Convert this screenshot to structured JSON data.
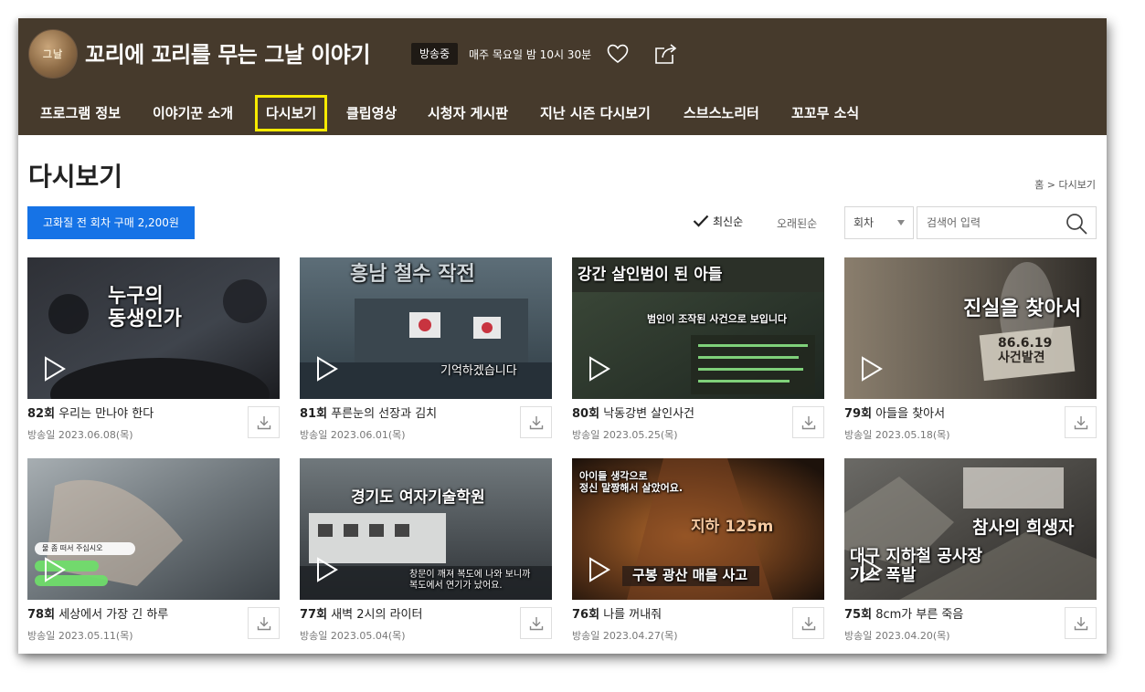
{
  "header": {
    "logo_text": "그날",
    "title": "꼬리에 꼬리를 무는 그날 이야기",
    "badge": "방송중",
    "schedule": "매주 목요일 밤 10시 30분",
    "heart_icon": "heart-icon",
    "share_icon": "share-icon"
  },
  "nav": {
    "items": [
      {
        "label": "프로그램 정보"
      },
      {
        "label": "이야기꾼 소개"
      },
      {
        "label": "다시보기",
        "active": true
      },
      {
        "label": "클립영상"
      },
      {
        "label": "시청자 게시판"
      },
      {
        "label": "지난 시즌 다시보기"
      },
      {
        "label": "스브스노리터"
      },
      {
        "label": "꼬꼬무 소식"
      }
    ],
    "active_color": "#f6ea00"
  },
  "page": {
    "title": "다시보기",
    "breadcrumb": "홈 > 다시보기"
  },
  "toolbar": {
    "buy_label": "고화질 전 회차 구매 2,200원",
    "sort_latest": "최신순",
    "sort_oldest": "오래된순",
    "select_value": "회차",
    "search_placeholder": "검색어 입력"
  },
  "colors": {
    "header_bg": "#463a2c",
    "accent_blue": "#1673e6",
    "highlight_yellow": "#f6ea00"
  },
  "episodes": [
    {
      "num": "82회",
      "title": "우리는 만나야 한다",
      "date": "방송일 2023.06.08(목)",
      "caption": "누구의\n동생인가"
    },
    {
      "num": "81회",
      "title": "푸른눈의 선장과 김치",
      "date": "방송일 2023.06.01(목)",
      "caption": "흥남 철수 작전",
      "caption2": "기억하겠습니다"
    },
    {
      "num": "80회",
      "title": "낙동강변 살인사건",
      "date": "방송일 2023.05.25(목)",
      "caption": "강간 살인범이 된 아들",
      "caption2": "범인이 조작된 사건으로 보입니다"
    },
    {
      "num": "79회",
      "title": "아들을 찾아서",
      "date": "방송일 2023.05.18(목)",
      "caption": "진실을 찾아서",
      "caption2": "86.6.19\n사건발견"
    },
    {
      "num": "78회",
      "title": "세상에서 가장 긴 하루",
      "date": "방송일 2023.05.11(목)",
      "caption": "",
      "caption2": "물 좀 떠서 주십시오"
    },
    {
      "num": "77회",
      "title": "새벽 2시의 라이터",
      "date": "방송일 2023.05.04(목)",
      "caption": "경기도 여자기술학원",
      "caption2": "창문이 깨져 복도에 나와 보니까\n복도에서 연기가 났어요."
    },
    {
      "num": "76회",
      "title": "나를 꺼내줘",
      "date": "방송일 2023.04.27(목)",
      "caption": "아이들 생각으로\n정신 말짱해서 살았어요.",
      "caption2": "지하 125m",
      "caption3": "구봉 광산 매몰 사고"
    },
    {
      "num": "75회",
      "title": "8cm가 부른 죽음",
      "date": "방송일 2023.04.20(목)",
      "caption": "참사의 희생자",
      "caption2": "대구 지하철 공사장\n가스 폭발"
    }
  ]
}
